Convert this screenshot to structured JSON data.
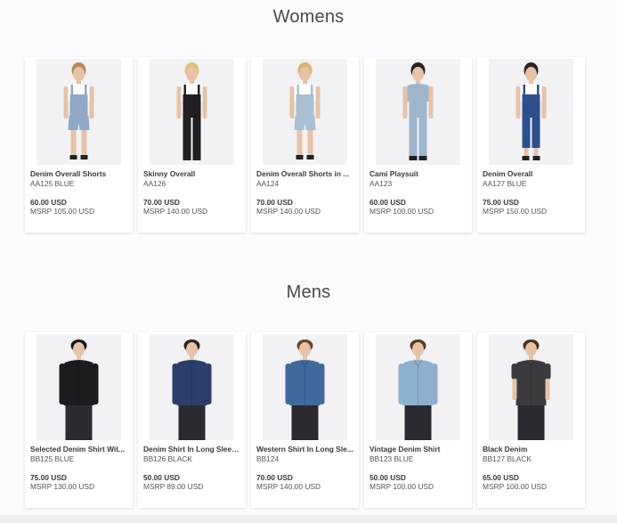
{
  "sections": [
    {
      "title": "Womens",
      "products": [
        {
          "name": "Denim Overall Shorts",
          "sku": "AA125 BLUE",
          "price": "60.00 USD",
          "msrp": "MSRP 105.00 USD",
          "image": "woman-denim-overall-shorts-photo",
          "garment": "#8fa9c4",
          "top": "#ffffff",
          "hair": "#b88a55",
          "style": "shorts"
        },
        {
          "name": "Skinny Overall",
          "sku": "AA126",
          "price": "70.00 USD",
          "msrp": "MSRP 140.00 USD",
          "image": "woman-black-skinny-overall-photo",
          "garment": "#1f1f24",
          "top": "#ffffff",
          "hair": "#e0c27a",
          "style": "long"
        },
        {
          "name": "Denim Overall Shorts in ...",
          "sku": "AA124",
          "price": "70.00 USD",
          "msrp": "MSRP 140.00 USD",
          "image": "woman-light-denim-overall-shorts-photo",
          "garment": "#a9bfd4",
          "top": "#ffffff",
          "hair": "#d9b36a",
          "style": "shorts"
        },
        {
          "name": "Cami Playsuit",
          "sku": "AA123",
          "price": "60.00 USD",
          "msrp": "MSRP 100.00 USD",
          "image": "woman-denim-cami-playsuit-photo",
          "garment": "#9db6cc",
          "top": "#9db6cc",
          "hair": "#2b2320",
          "style": "long"
        },
        {
          "name": "Denim Overall",
          "sku": "AA127 BLUE",
          "price": "75.00 USD",
          "msrp": "MSRP 150.00 USD",
          "image": "woman-dark-denim-overall-photo",
          "garment": "#2d4f8e",
          "top": "#ffffff",
          "hair": "#2b2320",
          "style": "cropped"
        }
      ]
    },
    {
      "title": "Mens",
      "products": [
        {
          "name": "Selected Denim Shirt Wit...",
          "sku": "BB125 BLUE",
          "price": "75.00 USD",
          "msrp": "MSRP 130.00 USD",
          "image": "man-black-denim-shirt-photo",
          "garment": "#1c1c1f",
          "top": "#1c1c1f",
          "hair": "#1a1a1a",
          "style": "shirt"
        },
        {
          "name": "Denim Shirt In Long Sleev...",
          "sku": "BB126 BLACK",
          "price": "50.00 USD",
          "msrp": "MSRP 89.00 USD",
          "image": "man-dark-denim-shirt-photo",
          "garment": "#2c3e6b",
          "top": "#2c3e6b",
          "hair": "#2a2018",
          "style": "shirt"
        },
        {
          "name": "Western Shirt In Long Sle...",
          "sku": "BB124",
          "price": "70.00 USD",
          "msrp": "MSRP 140.00 USD",
          "image": "man-western-denim-shirt-photo",
          "garment": "#3f6a9e",
          "top": "#3f6a9e",
          "hair": "#6b4426",
          "style": "shirt"
        },
        {
          "name": "Vintage Denim Shirt",
          "sku": "BB123 BLUE",
          "price": "50.00 USD",
          "msrp": "MSRP 100.00 USD",
          "image": "man-vintage-denim-shirt-photo",
          "garment": "#8db0cf",
          "top": "#8db0cf",
          "hair": "#5a3c22",
          "style": "shirt"
        },
        {
          "name": "Black Denim",
          "sku": "BB127 BLACK",
          "price": "65.00 USD",
          "msrp": "MSRP 100.00 USD",
          "image": "man-black-denim-short-sleeve-photo",
          "garment": "#3b3b3f",
          "top": "#3b3b3f",
          "hair": "#4a3020",
          "style": "shortsleeve"
        }
      ]
    }
  ]
}
